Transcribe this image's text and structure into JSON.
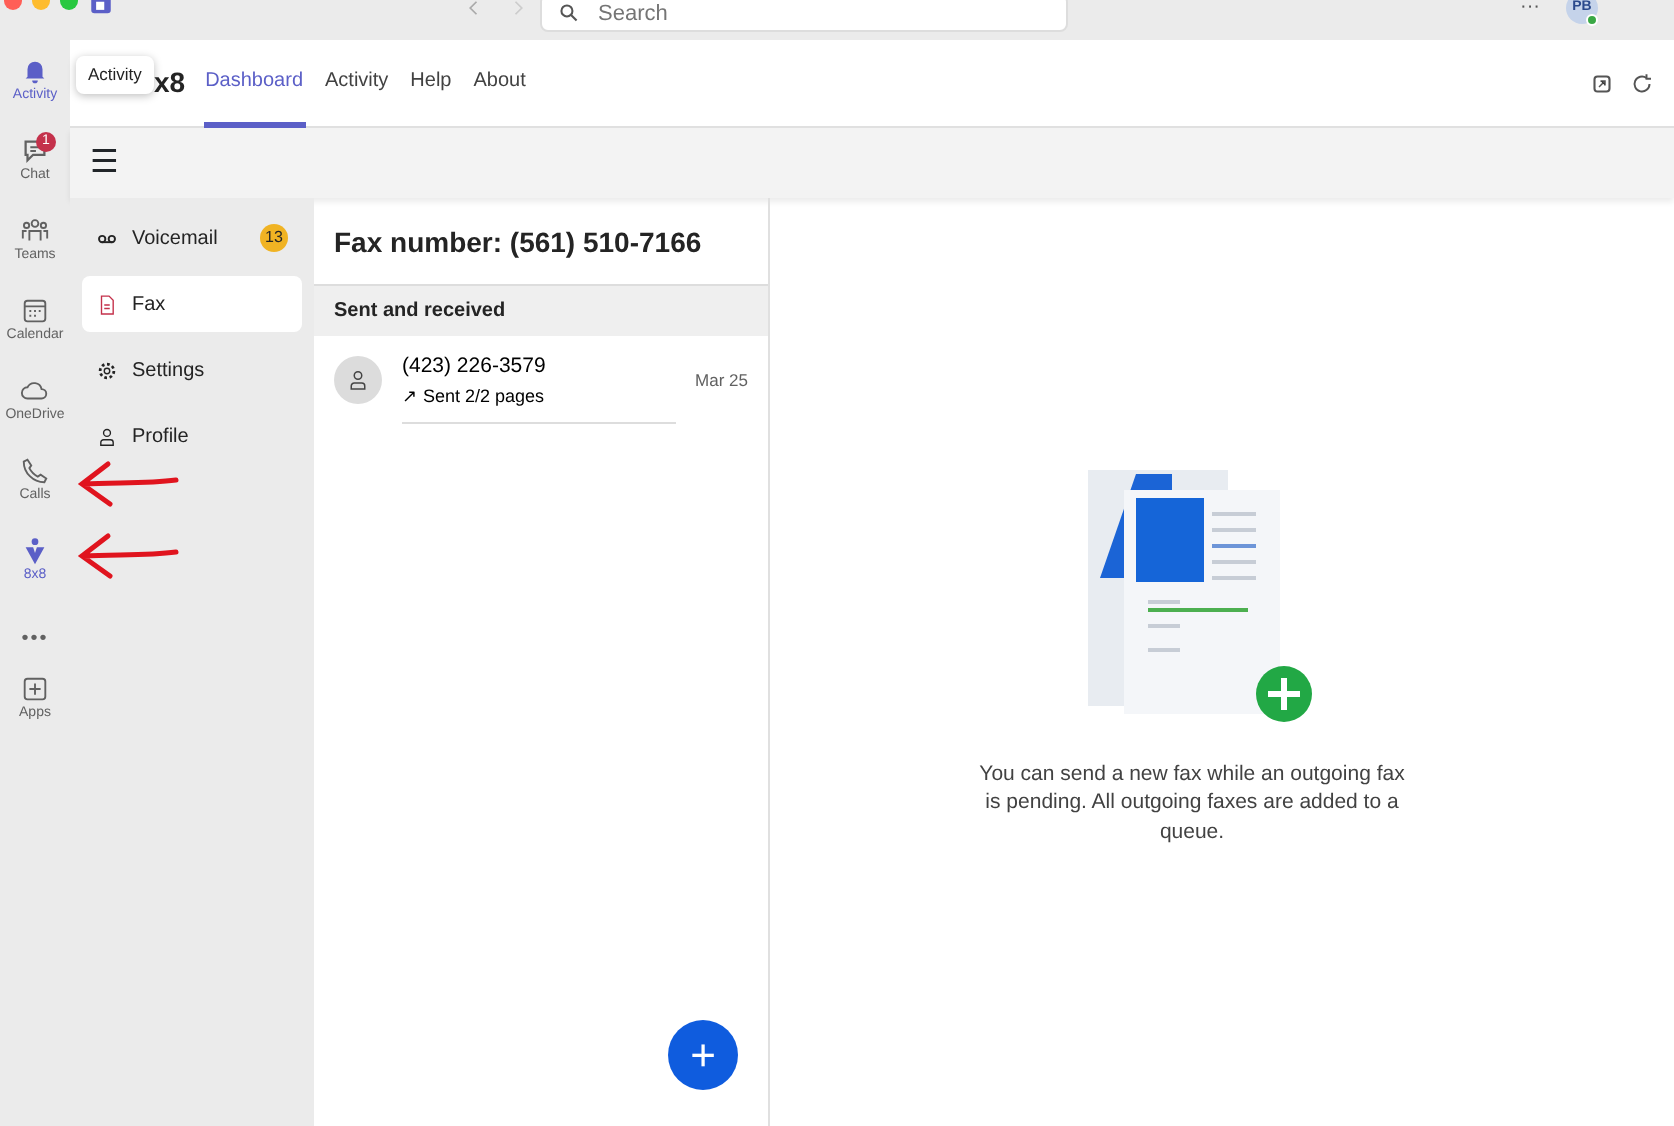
{
  "titlebar": {
    "search": {
      "placeholder": "Search"
    },
    "more": "···",
    "avatar": {
      "initials": "PB"
    }
  },
  "rail": [
    {
      "label": "Activity",
      "kind": "app",
      "selected": true
    },
    {
      "label": "Chat",
      "kind": "app",
      "selected": false,
      "badge": "1"
    },
    {
      "label": "Teams",
      "kind": "app",
      "selected": false
    },
    {
      "label": "Calendar",
      "kind": "app",
      "selected": false
    },
    {
      "label": "OneDrive",
      "kind": "app",
      "selected": false
    },
    {
      "label": "Calls",
      "kind": "app",
      "selected": false
    },
    {
      "label": "8x8",
      "kind": "app",
      "selected": true
    },
    {
      "label": "•••",
      "kind": "more",
      "selected": false
    },
    {
      "label": "Apps",
      "kind": "app",
      "selected": false
    }
  ],
  "tooltip": "Activity",
  "app": {
    "title": "x8",
    "tabs": [
      {
        "label": "Dashboard",
        "selected": true
      },
      {
        "label": "Activity",
        "selected": false
      },
      {
        "label": "Help",
        "selected": false
      },
      {
        "label": "About",
        "selected": false
      }
    ]
  },
  "toolbar": {
    "menu": "☰"
  },
  "sidebar": [
    {
      "label": "Voicemail",
      "selected": false,
      "badge": "13"
    },
    {
      "label": "Fax",
      "selected": true
    },
    {
      "label": "Settings",
      "selected": false
    },
    {
      "label": "Profile",
      "selected": false
    }
  ],
  "fax": {
    "title": "Fax number: (561) 510-7166",
    "section": "Sent and received",
    "items": [
      {
        "number": "(423) 226-3579",
        "status": "↗ Sent 2/2 pages",
        "date": "Mar 25"
      }
    ],
    "fab": "+"
  },
  "empty_state": {
    "message": "You can send a new fax while an outgoing fax is pending. All outgoing faxes are added to a queue."
  },
  "annotations": [
    {
      "kind": "arrow"
    },
    {
      "kind": "arrow"
    }
  ]
}
